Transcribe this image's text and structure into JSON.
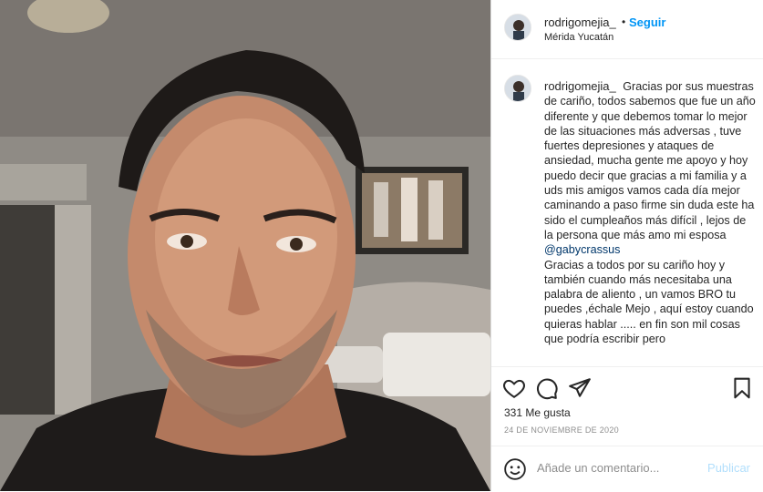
{
  "post": {
    "username": "rodrigomejia_",
    "dot": "•",
    "follow_label": "Seguir",
    "location": "Mérida Yucatán"
  },
  "caption": {
    "username": "rodrigomejia_",
    "text_before": "Gracias por sus muestras de cariño, todos sabemos que fue un año diferente y que debemos tomar lo mejor de las situaciones más adversas , tuve fuertes depresiones y ataques de ansiedad, mucha gente me apoyo y hoy puedo decir que gracias a mi familia y a uds mis amigos vamos cada día mejor caminando a paso firme sin duda este ha sido el cumpleaños más difícil , lejos de la persona que más amo mi esposa",
    "mention": "@gabycrassus",
    "text_after": "Gracias a todos por su cariño hoy y también cuando más necesitaba una palabra de aliento , un vamos BRO tu puedes ,échale Mejo , aquí estoy cuando quieras hablar ..... en fin son mil cosas que podría escribir pero"
  },
  "stats": {
    "likes": "331 Me gusta",
    "date": "24 DE NOVIEMBRE DE 2020"
  },
  "comment_box": {
    "placeholder": "Añade un comentario...",
    "publish_label": "Publicar"
  },
  "colors": {
    "accent": "#0095f6",
    "publish_disabled": "#b2dffc",
    "mention": "#00376b"
  },
  "icons": [
    "heart-icon",
    "comment-icon",
    "share-icon",
    "bookmark-icon",
    "emoji-icon"
  ]
}
